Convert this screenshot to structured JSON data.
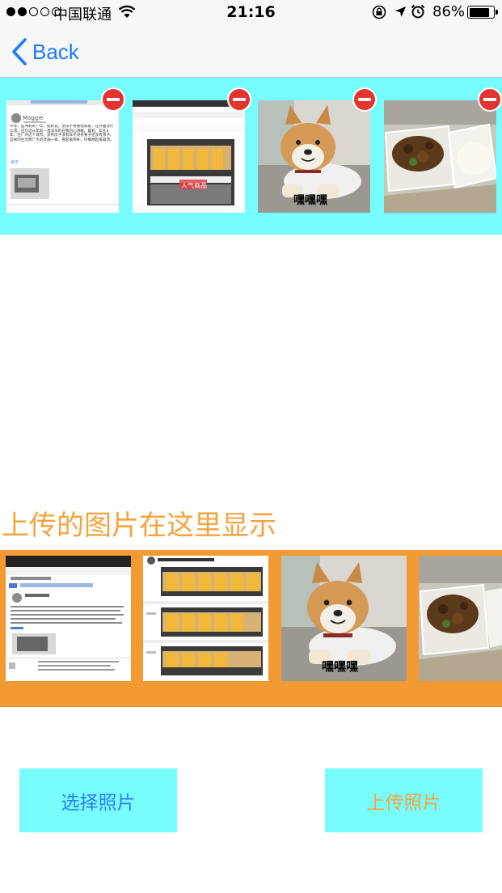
{
  "status_bar": {
    "carrier": "中国联通",
    "time": "21:16",
    "battery": "86%",
    "battery_level": 0.86,
    "icons": [
      "signal-dots",
      "wifi-icon",
      "rotation-lock-icon",
      "location-arrow-icon",
      "alarm-clock-icon",
      "battery-icon"
    ]
  },
  "nav": {
    "back_label": "Back",
    "back_icon": "chevron-left-icon",
    "tint": "#1e7cf6"
  },
  "selected_photos": {
    "background": "#77fdfe",
    "items": [
      {
        "name": "social-post-screenshot",
        "profile_name": "Maggie",
        "text": "今年，是冲刺的一年。挺好说，女孩子要重视家庭，在外面漂什么漂。这句话从年前一直深深的在我内心滑载。最初，毕业4年，在广州这个城市，没有房子没有车子没有要子还没有孩子。这样的生活像广大的普通一样，看起来简朴，仔细想起来崩溃。",
        "link": "全文"
      },
      {
        "name": "juice-shelf-screenshot",
        "tag": "人气商品"
      },
      {
        "name": "shiba-dog-meme",
        "caption": "嘿嘿嘿"
      },
      {
        "name": "food-box-photo"
      }
    ],
    "delete_icon": "minus-circle-icon",
    "delete_color": "#e3342f"
  },
  "uploaded": {
    "heading": "上传的图片在这里显示",
    "heading_color": "#f5a33d",
    "background": "#f39a33",
    "items": [
      {
        "name": "social-post-screenshot"
      },
      {
        "name": "juice-shelf-long-screenshot"
      },
      {
        "name": "shiba-dog-meme",
        "caption": "嘿嘿嘿"
      },
      {
        "name": "food-box-photo"
      }
    ]
  },
  "buttons": {
    "select_label": "选择照片",
    "upload_label": "上传照片",
    "background": "#77fdfe"
  }
}
